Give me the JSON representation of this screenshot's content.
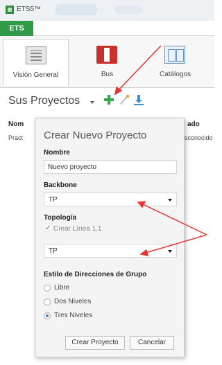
{
  "window": {
    "app_title": "ETS5™"
  },
  "topbar": {
    "ets_tab": "ETS"
  },
  "ribbon": {
    "tabs": [
      {
        "label": "Visión General",
        "icon": "overview-icon"
      },
      {
        "label": "Bus",
        "icon": "bus-icon"
      },
      {
        "label": "Catálogos",
        "icon": "catalog-icon"
      }
    ]
  },
  "projects": {
    "title": "Sus Proyectos",
    "columns": [
      "Nom",
      "ado"
    ],
    "row": [
      "Pract",
      "sconocido"
    ]
  },
  "dialog": {
    "title": "Crear Nuevo Proyecto",
    "name_label": "Nombre",
    "name_value": "Nuevo proyecto",
    "backbone_label": "Backbone",
    "backbone_value": "TP",
    "topology_label": "Topología",
    "create_line_label": "Crear Línea 1.1",
    "topology_value": "TP",
    "group_style_label": "Estilo de Direcciones de Grupo",
    "group_styles": [
      {
        "label": "Libre",
        "selected": false
      },
      {
        "label": "Dos Niveles",
        "selected": false
      },
      {
        "label": "Tres Niveles",
        "selected": true
      }
    ],
    "create_button": "Crear Proyecto",
    "cancel_button": "Cancelar"
  },
  "colors": {
    "ets_green": "#2f9a47",
    "add_green": "#2fa84a",
    "annotation_red": "#e8342f",
    "radio_blue": "#3a7ed8"
  }
}
